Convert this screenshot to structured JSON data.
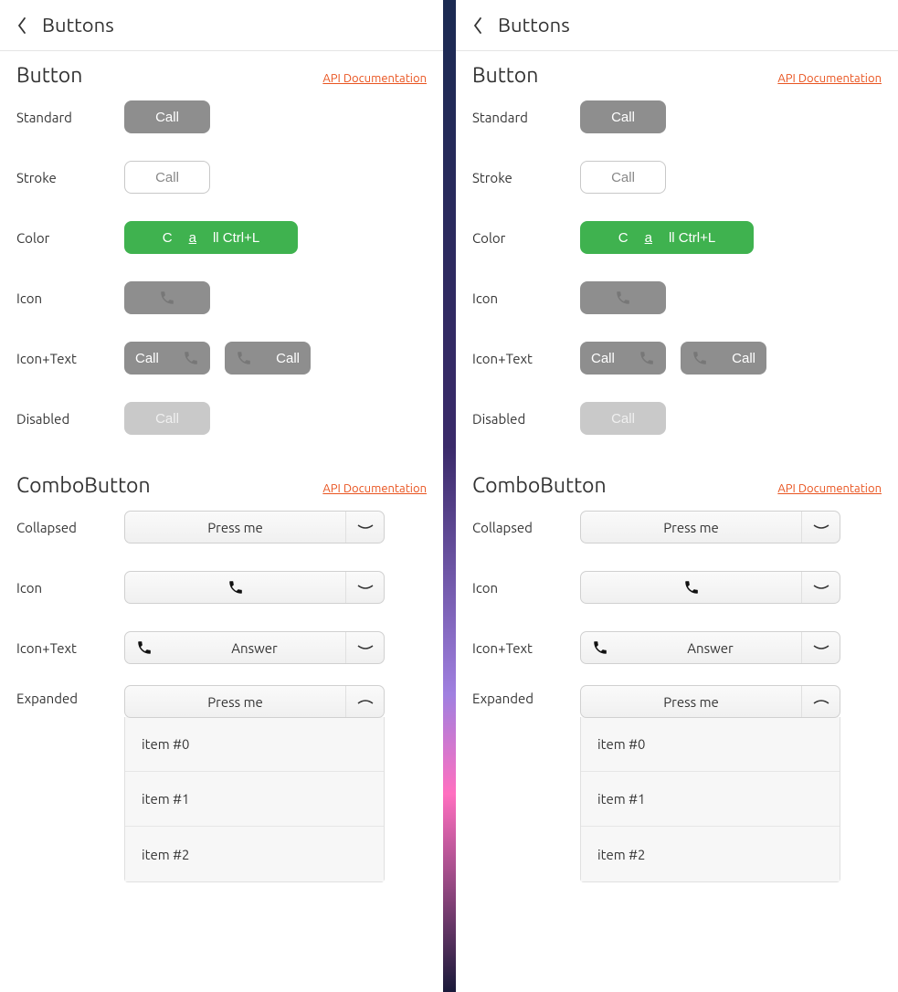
{
  "header": {
    "title": "Buttons"
  },
  "sections": {
    "button": {
      "title": "Button",
      "api_link": "API Documentation",
      "rows": {
        "standard": {
          "label": "Standard",
          "btn": "Call"
        },
        "stroke": {
          "label": "Stroke",
          "btn": "Call"
        },
        "color": {
          "label": "Color",
          "btn_pre": "C",
          "btn_u": "a",
          "btn_post": "ll Ctrl+L"
        },
        "icon": {
          "label": "Icon"
        },
        "icontext": {
          "label": "Icon+Text",
          "btn1": "Call",
          "btn2": "Call"
        },
        "disabled": {
          "label": "Disabled",
          "btn": "Call"
        }
      }
    },
    "combo": {
      "title": "ComboButton",
      "api_link": "API Documentation",
      "rows": {
        "collapsed": {
          "label": "Collapsed",
          "btn": "Press me"
        },
        "icon": {
          "label": "Icon"
        },
        "icontext": {
          "label": "Icon+Text",
          "btn": "Answer"
        },
        "expanded": {
          "label": "Expanded",
          "btn": "Press me",
          "items": [
            "item #0",
            "item #1",
            "item #2"
          ]
        }
      }
    }
  }
}
